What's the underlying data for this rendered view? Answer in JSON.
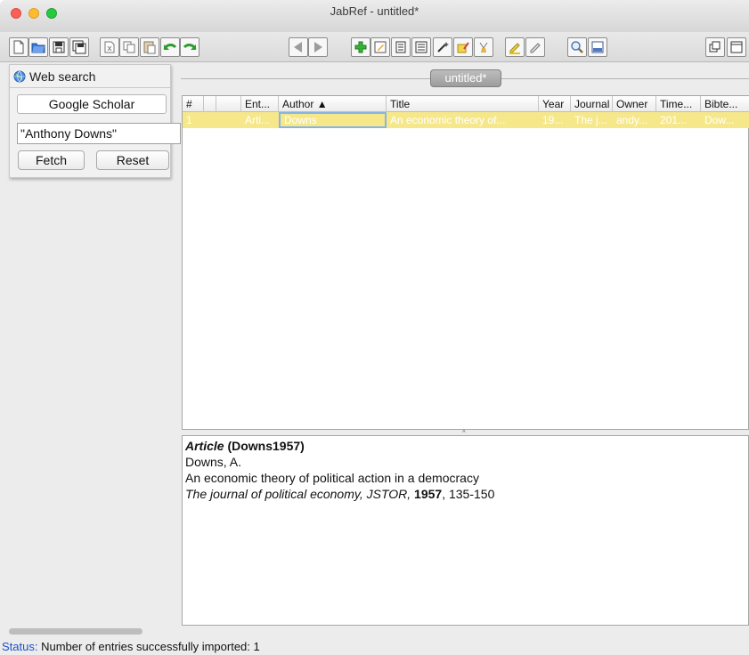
{
  "window": {
    "title": "JabRef - untitled*"
  },
  "sidepanel": {
    "title": "Web search",
    "engine": "Google Scholar",
    "query": "\"Anthony Downs\"",
    "fetch_label": "Fetch",
    "reset_label": "Reset"
  },
  "tab": {
    "label": "untitled*"
  },
  "table": {
    "columns": [
      "#",
      "Ent...",
      "Author ▲",
      "Title",
      "Year",
      "Journal",
      "Owner",
      "Time...",
      "Bibte..."
    ],
    "rows": [
      [
        "1",
        "Arti...",
        "Downs",
        "An economic theory of...",
        "19...",
        "The j...",
        "andy...",
        "201...",
        "Dow..."
      ]
    ]
  },
  "preview": {
    "type": "Article",
    "key": " (Downs1957)",
    "author": "Downs, A.",
    "title": "An economic theory of political action in a democracy",
    "journal": "The journal of political economy, JSTOR,",
    "year": "1957",
    "pages": ", 135-150"
  },
  "status": {
    "label": "Status:",
    "text": " Number of entries successfully imported: 1"
  },
  "colors": {
    "selected_row": "#f6e88a",
    "status_label": "#1c4fc9"
  }
}
